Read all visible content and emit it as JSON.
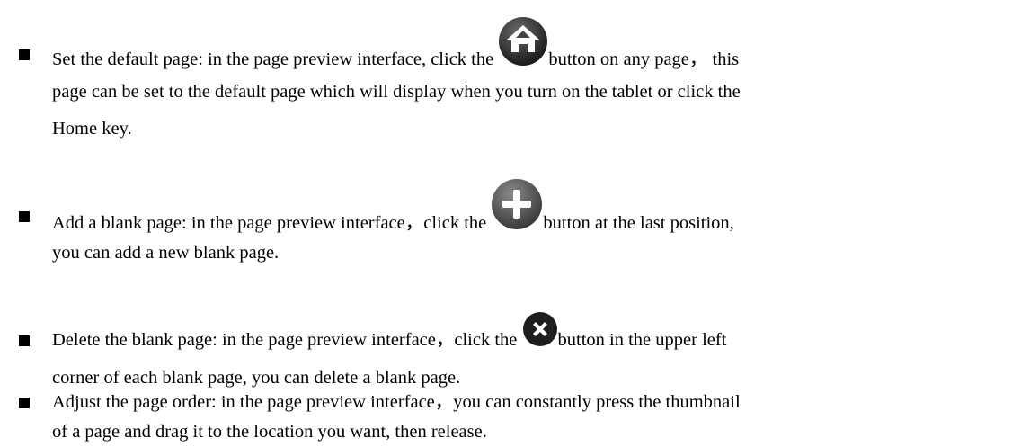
{
  "items": [
    {
      "line1_before": "Set the default page: in the page preview interface, click the ",
      "icon": "home-icon",
      "line1_after": "button on any page，  this",
      "line2": "page can be set to the default page which will display when you turn on the tablet or click the",
      "line3": "Home key."
    },
    {
      "line1_before": "Add a blank page: in the page preview interface，click the ",
      "icon": "plus-icon",
      "line1_after": "button at the last position,",
      "line2": "you can add a new blank page."
    },
    {
      "line1_before": "Delete the blank page: in the page preview interface，click the ",
      "icon": "close-icon",
      "line1_after": "button in the upper left",
      "line2": "corner of each blank page, you can delete a blank page."
    },
    {
      "line1": "Adjust the page order: in the page preview interface，you can constantly press the thumbnail",
      "line2": "of a page and drag it to the location you want, then release."
    }
  ]
}
